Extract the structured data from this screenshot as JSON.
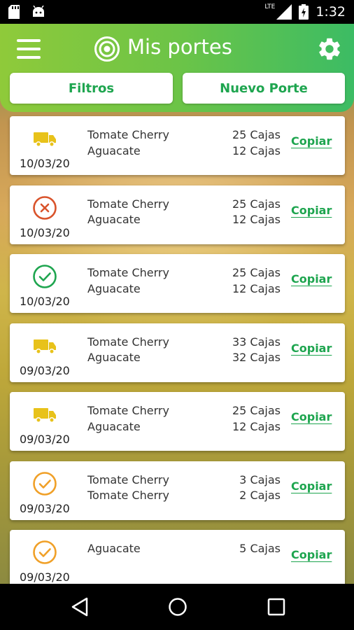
{
  "status_bar": {
    "time": "1:32",
    "network": "LTE",
    "icons": [
      "sd-card-icon",
      "android-icon",
      "signal-icon",
      "battery-charging-icon"
    ]
  },
  "app_bar": {
    "title": "Mis portes",
    "menu_icon": "menu-icon",
    "logo_icon": "target-icon",
    "settings_icon": "gear-icon"
  },
  "actions": {
    "filter_label": "Filtros",
    "new_label": "Nuevo Porte"
  },
  "colors": {
    "accent": "#1ea54f",
    "truck": "#e8c21a",
    "rejected": "#d9532b",
    "done_green": "#1ea54f",
    "done_orange": "#f0a028"
  },
  "portes": [
    {
      "status": "truck",
      "date": "10/03/20",
      "products": [
        "Tomate Cherry",
        "Aguacate"
      ],
      "quantities": [
        "25 Cajas",
        "12 Cajas"
      ],
      "copy_label": "Copiar"
    },
    {
      "status": "rejected",
      "date": "10/03/20",
      "products": [
        "Tomate Cherry",
        "Aguacate"
      ],
      "quantities": [
        "25 Cajas",
        "12 Cajas"
      ],
      "copy_label": "Copiar"
    },
    {
      "status": "done-green",
      "date": "10/03/20",
      "products": [
        "Tomate Cherry",
        "Aguacate"
      ],
      "quantities": [
        "25 Cajas",
        "12 Cajas"
      ],
      "copy_label": "Copiar"
    },
    {
      "status": "truck",
      "date": "09/03/20",
      "products": [
        "Tomate Cherry",
        "Aguacate"
      ],
      "quantities": [
        "33 Cajas",
        "32 Cajas"
      ],
      "copy_label": "Copiar"
    },
    {
      "status": "truck",
      "date": "09/03/20",
      "products": [
        "Tomate Cherry",
        "Aguacate"
      ],
      "quantities": [
        "25 Cajas",
        "12 Cajas"
      ],
      "copy_label": "Copiar"
    },
    {
      "status": "done-orange",
      "date": "09/03/20",
      "products": [
        "Tomate Cherry",
        "Tomate Cherry"
      ],
      "quantities": [
        "3 Cajas",
        "2 Cajas"
      ],
      "copy_label": "Copiar"
    },
    {
      "status": "done-orange",
      "date": "09/03/20",
      "products": [
        "Aguacate"
      ],
      "quantities": [
        "5 Cajas"
      ],
      "copy_label": "Copiar"
    }
  ],
  "nav_bar": {
    "icons": [
      "back-icon",
      "home-icon",
      "recents-icon"
    ]
  }
}
